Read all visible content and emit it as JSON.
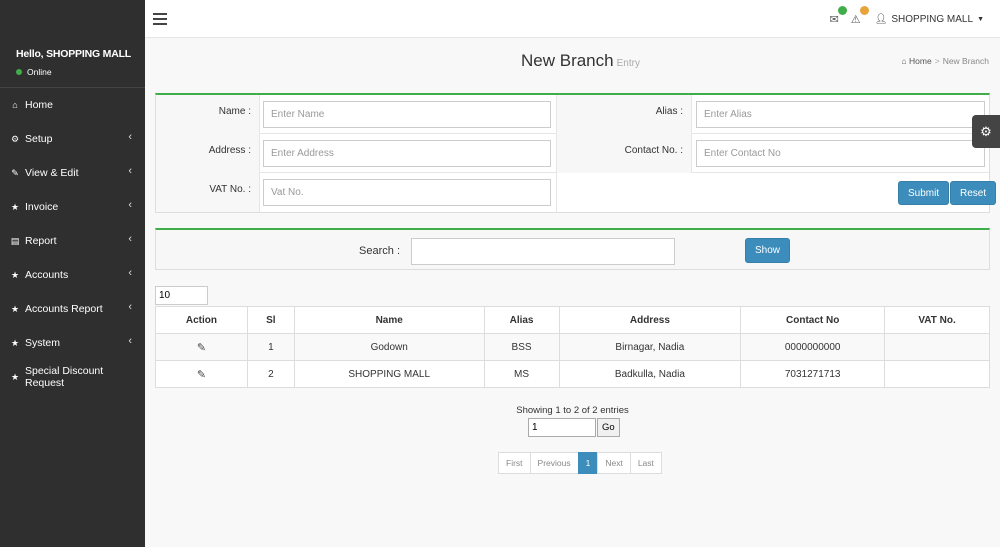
{
  "sidebar": {
    "greeting": "Hello, SHOPPING MALL",
    "status": "Online",
    "items": [
      {
        "label": "Home",
        "icon": "home-icon",
        "glyph": "⌂",
        "chevron": false
      },
      {
        "label": "Setup",
        "icon": "cogs-icon",
        "glyph": "⚙",
        "chevron": true
      },
      {
        "label": "View & Edit",
        "icon": "edit-icon",
        "glyph": "✎",
        "chevron": true
      },
      {
        "label": "Invoice",
        "icon": "star-icon",
        "glyph": "★",
        "chevron": true
      },
      {
        "label": "Report",
        "icon": "file-icon",
        "glyph": "▤",
        "chevron": true
      },
      {
        "label": "Accounts",
        "icon": "star-icon",
        "glyph": "★",
        "chevron": true
      },
      {
        "label": "Accounts Report",
        "icon": "star-icon",
        "glyph": "★",
        "chevron": true
      },
      {
        "label": "System",
        "icon": "star-icon",
        "glyph": "★",
        "chevron": true
      },
      {
        "label": "Special Discount Request",
        "icon": "star-icon",
        "glyph": "★",
        "chevron": false
      }
    ]
  },
  "topbar": {
    "user": "SHOPPING MALL",
    "colors": {
      "mail_badge": "#3fae49",
      "alert_badge": "#e8a33b"
    }
  },
  "page": {
    "title": "New Branch",
    "subtitle": "Entry",
    "breadcrumb": {
      "home": "Home",
      "current": "New Branch"
    }
  },
  "form": {
    "name_label": "Name :",
    "name_placeholder": "Enter Name",
    "alias_label": "Alias :",
    "alias_placeholder": "Enter Alias",
    "address_label": "Address :",
    "address_placeholder": "Enter Address",
    "contact_label": "Contact No. :",
    "contact_placeholder": "Enter Contact No",
    "vat_label": "VAT No. :",
    "vat_placeholder": "Vat No.",
    "submit": "Submit",
    "reset": "Reset"
  },
  "search": {
    "label": "Search :",
    "button": "Show"
  },
  "table": {
    "page_length": "10",
    "headers": [
      "Action",
      "Sl",
      "Name",
      "Alias",
      "Address",
      "Contact No",
      "VAT No."
    ],
    "rows": [
      {
        "sl": "1",
        "name": "Godown",
        "alias": "BSS",
        "address": "Birnagar, Nadia",
        "contact": "0000000000",
        "vat": ""
      },
      {
        "sl": "2",
        "name": "SHOPPING MALL",
        "alias": "MS",
        "address": "Badkulla, Nadia",
        "contact": "7031271713",
        "vat": ""
      }
    ]
  },
  "footer": {
    "info": "Showing 1 to 2 of 2 entries",
    "goto_value": "1",
    "go": "Go",
    "pager": {
      "first": "First",
      "previous": "Previous",
      "current": "1",
      "next": "Next",
      "last": "Last"
    }
  }
}
